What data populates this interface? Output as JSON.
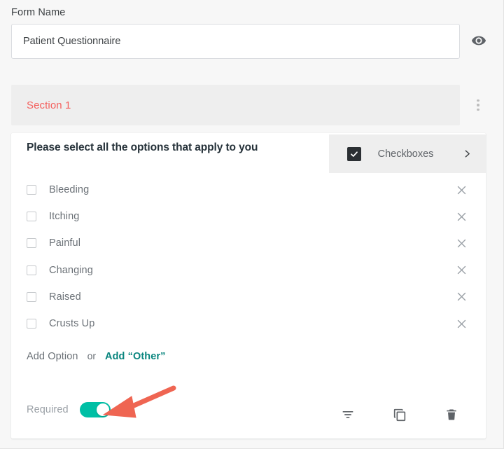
{
  "form": {
    "name_label": "Form Name",
    "name_value": "Patient Questionnaire",
    "name_placeholder": "Form Name",
    "preview_icon": "eye-icon"
  },
  "section": {
    "title": "Section 1",
    "menu_icon": "vertical-dots-icon",
    "title_color": "#f4605e",
    "background": "#eeeeee"
  },
  "question": {
    "title": "Please select all the options that apply to you",
    "type": {
      "label": "Checkboxes",
      "icon": "checked-checkbox-icon",
      "chevron": "chevron-right-icon"
    },
    "options": [
      {
        "label": "Bleeding",
        "checked": false,
        "remove_icon": "close-icon"
      },
      {
        "label": "Itching",
        "checked": false,
        "remove_icon": "close-icon"
      },
      {
        "label": "Painful",
        "checked": false,
        "remove_icon": "close-icon"
      },
      {
        "label": "Changing",
        "checked": false,
        "remove_icon": "close-icon"
      },
      {
        "label": "Raised",
        "checked": false,
        "remove_icon": "close-icon"
      },
      {
        "label": "Crusts Up",
        "checked": false,
        "remove_icon": "close-icon"
      }
    ],
    "add": {
      "add_option": "Add Option",
      "or": "or",
      "add_other": "Add “Other”",
      "add_other_color": "#09857e"
    },
    "footer": {
      "required_label": "Required",
      "required_on": true,
      "toggle_color": "#00bfa5",
      "icons": [
        {
          "name": "sort-lines-icon"
        },
        {
          "name": "duplicate-icon"
        },
        {
          "name": "trash-icon"
        }
      ]
    }
  },
  "annotation": {
    "arrow_color": "#ef6552"
  }
}
